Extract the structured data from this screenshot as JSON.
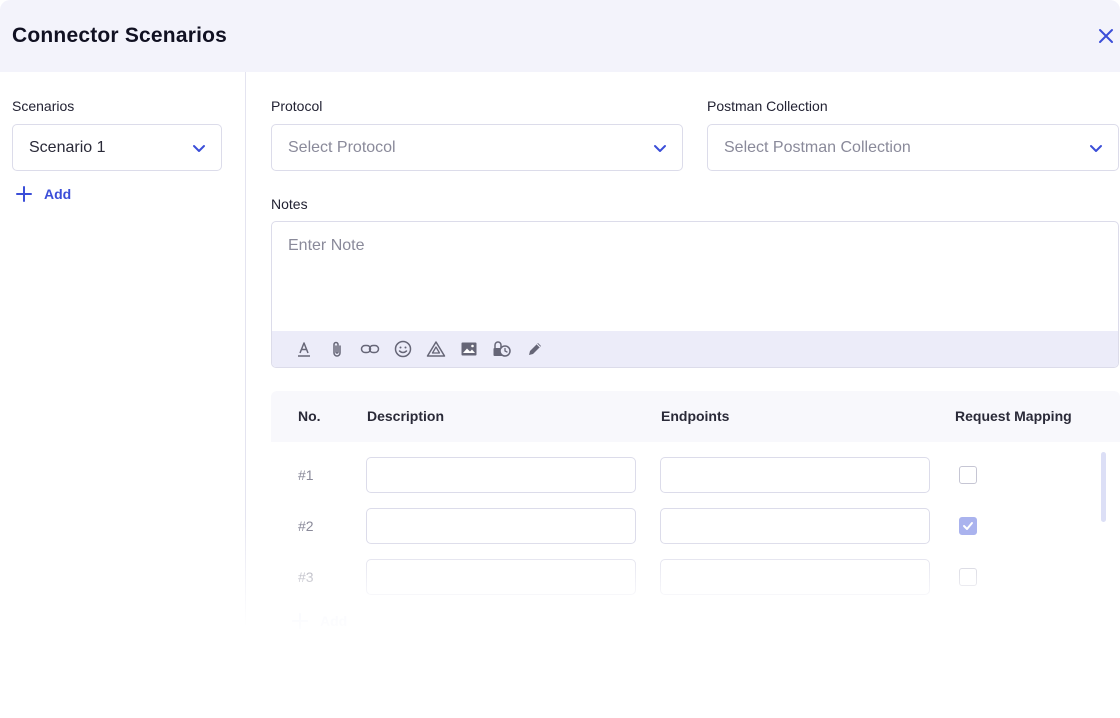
{
  "header": {
    "title": "Connector Scenarios",
    "close_icon": "close-icon",
    "accent": "#3b4ed8"
  },
  "sidebar": {
    "label": "Scenarios",
    "selected_scenario": "Scenario 1",
    "add_label": "Add"
  },
  "form": {
    "protocol": {
      "label": "Protocol",
      "placeholder": "Select Protocol"
    },
    "postman": {
      "label": "Postman Collection",
      "placeholder": "Select Postman Collection"
    },
    "notes": {
      "label": "Notes",
      "placeholder": "Enter Note",
      "toolbar": [
        "text-format-icon",
        "attachment-icon",
        "link-icon",
        "emoji-icon",
        "drive-icon",
        "image-icon",
        "lock-clock-icon",
        "pen-icon"
      ]
    }
  },
  "table": {
    "headers": {
      "no": "No.",
      "description": "Description",
      "endpoints": "Endpoints",
      "request_mapping": "Request Mapping"
    },
    "rows": [
      {
        "no": "#1",
        "description": "",
        "endpoint": "",
        "request_mapping": false
      },
      {
        "no": "#2",
        "description": "",
        "endpoint": "",
        "request_mapping": true
      },
      {
        "no": "#3",
        "description": "",
        "endpoint": "",
        "request_mapping": false
      }
    ],
    "add_label": "Add"
  }
}
